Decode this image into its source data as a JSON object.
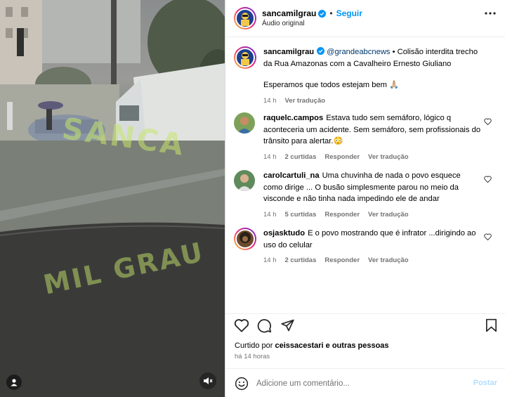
{
  "media": {
    "watermark_top": "SANCA",
    "watermark_bottom": "MIL GRAU",
    "user_tag_icon": "user-icon",
    "mute_icon": "speaker-muted-icon"
  },
  "header": {
    "username": "sancamilgrau",
    "verified": true,
    "separator": "•",
    "follow_label": "Seguir",
    "audio_label": "Áudio original",
    "more_icon": "more-horizontal-icon"
  },
  "caption": {
    "username": "sancamilgrau",
    "mention": "@grandeabcnews",
    "text_main": " • Colisão interdita trecho da Rua Amazonas com a Cavalheiro Ernesto Giuliano",
    "text_second": "Esperamos que todos estejam bem 🙏🏼",
    "time": "14 h",
    "translate_label": "Ver tradução"
  },
  "comments": [
    {
      "username": "raquelc.campos",
      "text": "Estava tudo sem semáforo, lógico q aconteceria um acidente. Sem semáforo, sem profissionais do trânsito para alertar.😳",
      "time": "14 h",
      "likes": "2 curtidas",
      "reply_label": "Responder",
      "translate_label": "Ver tradução"
    },
    {
      "username": "carolcartuli_na",
      "text": "Uma chuvinha de nada o povo esquece como dirige ... O busão simplesmente parou no meio da visconde e não tinha nada impedindo ele de andar",
      "time": "14 h",
      "likes": "5 curtidas",
      "reply_label": "Responder",
      "translate_label": "Ver tradução"
    },
    {
      "username": "osjasktudo",
      "text": "E o povo mostrando que é infrator ...dirigindo ao uso do celular",
      "time": "14 h",
      "likes": "2 curtidas",
      "reply_label": "Responder",
      "translate_label": "Ver tradução"
    }
  ],
  "actions": {
    "like_icon": "heart-icon",
    "comment_icon": "comment-icon",
    "share_icon": "send-icon",
    "save_icon": "bookmark-icon"
  },
  "likes_summary": {
    "prefix": "Curtido por ",
    "user": "ceissacestari",
    "suffix": " e outras pessoas"
  },
  "time_ago": "há 14 horas",
  "add_comment": {
    "emoji_icon": "emoji-icon",
    "placeholder": "Adicione um comentário...",
    "post_label": "Postar"
  },
  "colors": {
    "link_blue": "#0095f6",
    "mention_blue": "#00376b",
    "muted_text": "#737373",
    "post_disabled": "#b2dffc",
    "watermark_green": "#c6e66c"
  }
}
